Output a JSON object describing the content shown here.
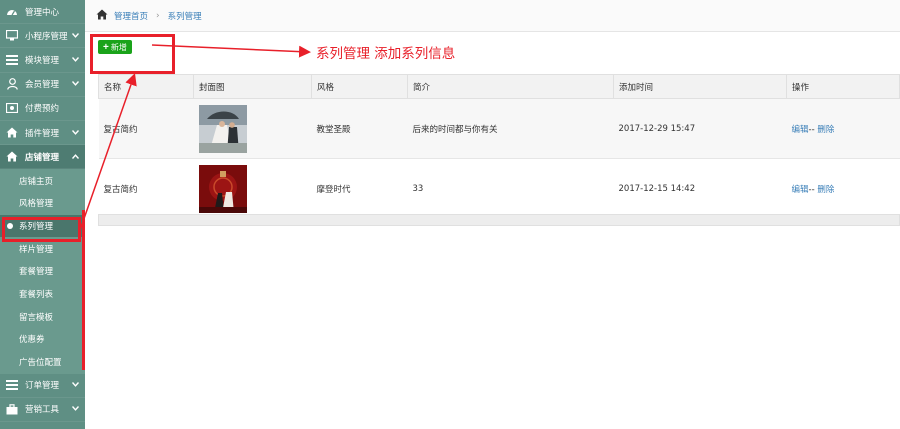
{
  "sidebar": {
    "items": [
      {
        "label": "管理中心",
        "icon": "dashboard-icon",
        "chevron": false
      },
      {
        "label": "小程序管理",
        "icon": "monitor-icon",
        "chevron": true
      },
      {
        "label": "模块管理",
        "icon": "list-icon",
        "chevron": true
      },
      {
        "label": "会员管理",
        "icon": "user-icon",
        "chevron": true
      },
      {
        "label": "付费预约",
        "icon": "money-icon",
        "chevron": false
      },
      {
        "label": "插件管理",
        "icon": "home-icon",
        "chevron": true
      },
      {
        "label": "店铺管理",
        "icon": "home-icon",
        "chevron": true
      }
    ],
    "subitems": [
      "店铺主页",
      "风格管理",
      "系列管理",
      "样片管理",
      "套餐管理",
      "套餐列表",
      "留言模板",
      "优惠券",
      "广告位配置"
    ],
    "bottom_items": [
      {
        "label": "订单管理",
        "icon": "list-icon",
        "chevron": true
      },
      {
        "label": "营销工具",
        "icon": "briefcase-icon",
        "chevron": true
      }
    ]
  },
  "breadcrumb": {
    "home": "管理首页",
    "current": "系列管理"
  },
  "toolbar": {
    "add_label": "新增"
  },
  "annotation": {
    "text": "系列管理  添加系列信息",
    "color": "#e8202a"
  },
  "table": {
    "columns": [
      "名称",
      "封面图",
      "风格",
      "简介",
      "添加时间",
      "操作"
    ],
    "rows": [
      {
        "name": "复古简约",
        "style": "教堂圣殿",
        "intro": "后来的时间都与你有关",
        "time": "2017-12-29 15:47",
        "edit": "编辑",
        "sep": "--",
        "delete": "删除"
      },
      {
        "name": "复古简约",
        "style": "摩登时代",
        "intro": "33",
        "time": "2017-12-15 14:42",
        "edit": "编辑",
        "sep": "--",
        "delete": "删除"
      }
    ]
  },
  "colors": {
    "sidebar": "#5f8f84",
    "accent_green": "#1aa31a",
    "link": "#3a7fb8",
    "annotation_red": "#e8202a"
  }
}
